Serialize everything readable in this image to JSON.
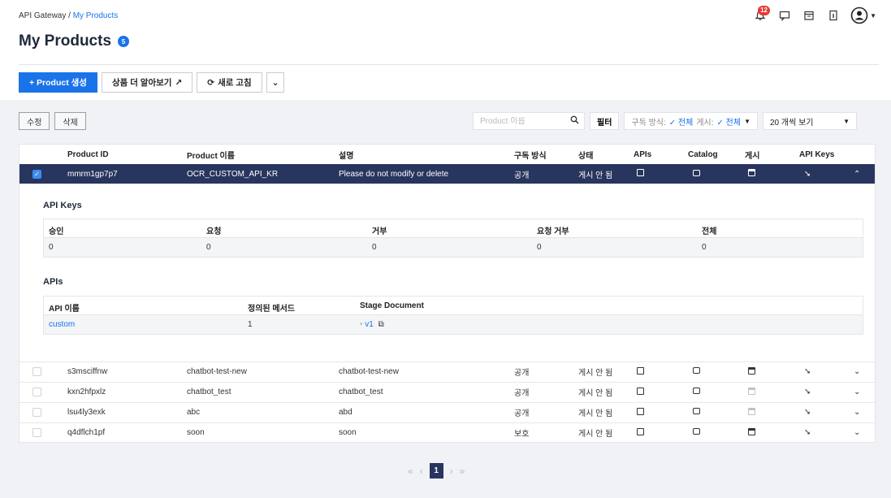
{
  "breadcrumb": {
    "root": "API Gateway",
    "sep": " / ",
    "current": "My Products"
  },
  "page": {
    "title": "My Products",
    "count": "5"
  },
  "header": {
    "notification_count": "12"
  },
  "actions": {
    "create": "+ Product 생성",
    "learn_more": "상품 더 알아보기",
    "refresh": "새로 고침"
  },
  "toolbar": {
    "edit": "수정",
    "delete": "삭제",
    "search_placeholder": "Product 이름",
    "filter": "필터",
    "subscription_label": "구독 방식:",
    "subscription_value": "✓ 전체",
    "publish_label": "게시:",
    "publish_value": "✓ 전체",
    "per_page": "20 개씩 보기"
  },
  "table": {
    "columns": {
      "id": "Product ID",
      "name": "Product 이름",
      "desc": "설명",
      "subscription": "구독 방식",
      "status": "상태",
      "apis": "APIs",
      "catalog": "Catalog",
      "publish": "게시",
      "keys": "API Keys"
    },
    "selected": {
      "id": "mmrm1gp7p7",
      "name": "OCR_CUSTOM_API_KR",
      "desc": "Please do not modify or delete",
      "subscription": "공개",
      "status": "게시 안 됨"
    },
    "rows": [
      {
        "id": "s3msciffnw",
        "name": "chatbot-test-new",
        "desc": "chatbot-test-new",
        "subscription": "공개",
        "status": "게시 안 됨"
      },
      {
        "id": "kxn2hfpxlz",
        "name": "chatbot_test",
        "desc": "chatbot_test",
        "subscription": "공개",
        "status": "게시 안 됨"
      },
      {
        "id": "lsu4ly3exk",
        "name": "abc",
        "desc": "abd",
        "subscription": "공개",
        "status": "게시 안 됨"
      },
      {
        "id": "q4dflch1pf",
        "name": "soon",
        "desc": "soon",
        "subscription": "보호",
        "status": "게시 안 됨"
      }
    ]
  },
  "detail": {
    "keys_title": "API Keys",
    "keys_columns": {
      "approved": "승인",
      "requested": "요청",
      "rejected": "거부",
      "request_rejected": "요청 거부",
      "total": "전체"
    },
    "keys_values": {
      "approved": "0",
      "requested": "0",
      "rejected": "0",
      "request_rejected": "0",
      "total": "0"
    },
    "apis_title": "APIs",
    "apis_columns": {
      "name": "API 이름",
      "methods": "정의된 메서드",
      "stage": "Stage Document"
    },
    "api_row": {
      "name": "custom",
      "methods": "1",
      "stage": "v1"
    }
  },
  "pagination": {
    "current": "1"
  }
}
